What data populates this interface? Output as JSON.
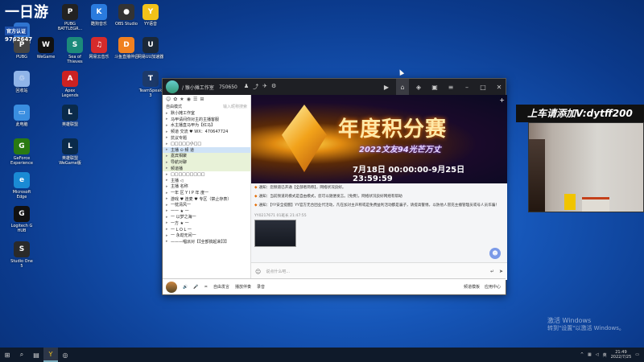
{
  "desktop": {
    "top_overlay": "一日游",
    "top_overlay_lines": [
      "官方认证",
      "9762647"
    ],
    "icons": [
      {
        "label": "Windows",
        "color": "#2f74d0",
        "glyph": "▣"
      },
      {
        "label": "PUBG\nBATTLEGR...",
        "color": "#222",
        "glyph": "P"
      },
      {
        "label": "酷狗音乐",
        "color": "#2a7bde",
        "glyph": "K"
      },
      {
        "label": "OBS Studio",
        "color": "#333",
        "glyph": "●"
      },
      {
        "label": "YY语音",
        "color": "#f2c21a",
        "glyph": "Y"
      },
      {
        "label": "PUBG",
        "color": "#444",
        "glyph": "P"
      },
      {
        "label": "WeGame",
        "color": "#111",
        "glyph": "W"
      },
      {
        "label": "Sea of\nThieves",
        "color": "#1c8a7a",
        "glyph": "S"
      },
      {
        "label": "网易云音乐",
        "color": "#d62b2b",
        "glyph": "♫"
      },
      {
        "label": "斗鱼直播伴侣",
        "color": "#f08020",
        "glyph": "D"
      },
      {
        "label": "网易UU加速器",
        "color": "#1b2838",
        "glyph": "U"
      },
      {
        "label": "回收站",
        "color": "#8fb4e8",
        "glyph": "♲"
      },
      {
        "label": "Apex\nLegends",
        "color": "#c22",
        "glyph": "A"
      },
      {
        "label": "TeamSpeak\n3",
        "color": "#1d3a6a",
        "glyph": "T"
      },
      {
        "label": "此电脑",
        "color": "#3a8ee0",
        "glyph": "▭"
      },
      {
        "label": "英雄联盟",
        "color": "#0a2a4a",
        "glyph": "L"
      },
      {
        "label": "GeForce\nExperience",
        "color": "#2a7a12",
        "glyph": "G"
      },
      {
        "label": "英雄联盟\nWeGame版",
        "color": "#0a2a4a",
        "glyph": "L"
      },
      {
        "label": "Microsoft\nEdge",
        "color": "#1a8ad4",
        "glyph": "e"
      },
      {
        "label": "Logitech G\nHUB",
        "color": "#111",
        "glyph": "G"
      },
      {
        "label": "Studio One\n5",
        "color": "#2a2a2a",
        "glyph": "S"
      }
    ]
  },
  "app": {
    "title": "/ 猴小摊工作室",
    "channel_id": "750650",
    "left": {
      "mode": "自由模式",
      "search_placeholder": "输入昵称搜索",
      "channels": [
        "默小摊工作室",
        "马甲请间你对主的主播客服",
        "水主播直马甲为【红马】",
        "频道 交流 ♥ WX：470647724",
        "抗议专题",
        "□□□□□小□□",
        "主播     ⊙ 频 道",
        "嘉宾相聚",
        "导航对聊",
        "频道播",
        "□□□□□□□□□",
        "主播       ◁",
        "主播       名称",
        "一年 区    Y I P      年 度一",
        "游戏 ♥ 连麦 ♥ 专区（禁止存表）",
        "一枕清风一",
        "一一 ★ 一",
        "一 以梦之海一",
        "一方 ★ 一",
        "一 L O L 一",
        "一 永劫无间一",
        "———唱派对【【全部搞起来】】】"
      ]
    },
    "banner": {
      "title": "年度积分赛",
      "subtitle": "2022文友94光芒万丈",
      "dates": "7月18日 00:00:00-9月25日 23:59:59"
    },
    "chat": {
      "messages": [
        "通知：您频道已开通【全部者简称】，网络状况良好。",
        "通知：当前频道的模式是自由模式，您可以随便发言。[免费]，网络状况良好网络有帮助",
        "通知：【YY安全提醒】YY官方无合团业代活动，凡在加对主声称或是免费益利活动都是骗子，请提高警惕，以防他人冒充主播管理员或号人员诈骗！"
      ],
      "meta": "YY0217671 01班长 21:47:55",
      "input_placeholder": "说点什么吧..."
    },
    "bottom": {
      "free_mode": "自由发言",
      "queue": "播放伴奏",
      "record": "录音",
      "channel_toggle": "频道模板",
      "apps": "应用中心"
    }
  },
  "overlay_ad": "上车请添加V:dytff200",
  "activation": {
    "title": "激活 Windows",
    "body": "转到\"设置\"以激活 Windows。"
  },
  "taskbar": {
    "time": "21:49",
    "date": "2022/7/25"
  }
}
